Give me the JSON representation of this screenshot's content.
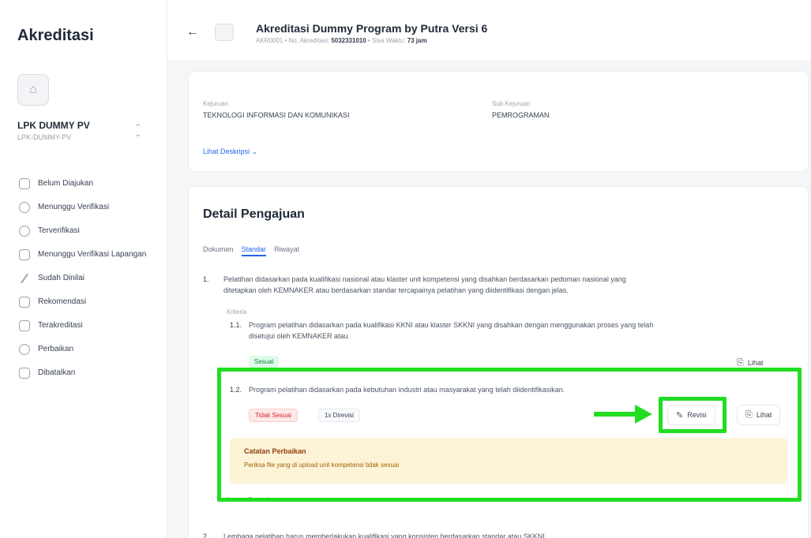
{
  "sidebar": {
    "app_title": "Akreditasi",
    "org_name": "LPK DUMMY PV",
    "org_code": "LPK-DUMMY-PV",
    "items": [
      {
        "label": "Belum Diajukan",
        "icon": "file-icon"
      },
      {
        "label": "Menunggu Verifikasi",
        "icon": "clock-icon"
      },
      {
        "label": "Terverifikasi",
        "icon": "check-circle-icon"
      },
      {
        "label": "Menunggu Verifikasi Lapangan",
        "icon": "map-icon"
      },
      {
        "label": "Sudah Dinilai",
        "icon": "pen-icon"
      },
      {
        "label": "Rekomendasi",
        "icon": "building-icon"
      },
      {
        "label": "Terakreditasi",
        "icon": "badge-icon"
      },
      {
        "label": "Perbaikan",
        "icon": "clock-icon"
      },
      {
        "label": "Dibatalkan",
        "icon": "clipboard-icon"
      }
    ]
  },
  "header": {
    "title": "Akreditasi Dummy Program by Putra Versi 6",
    "meta_prefix": "AKR0001 • No. Akreditasi:",
    "meta_number": "5032331010",
    "meta_mid": " • Sisa Waktu:",
    "meta_time": "73 jam"
  },
  "program": {
    "kejuruan_label": "Kejuruan",
    "kejuruan_value": "TEKNOLOGI INFORMASI DAN KOMUNIKASI",
    "sub_kejuruan_label": "Sub Kejuruan",
    "sub_kejuruan_value": "PEMROGRAMAN",
    "desc_link": "Lihat Deskripsi ⌄"
  },
  "detail": {
    "title": "Detail Pengajuan",
    "tabs": [
      "Dokumen",
      "Standar",
      "Riwayat"
    ],
    "standard_1": {
      "number": "1.",
      "text_line1": "Pelatihan didasarkan pada kualifikasi nasional atau klaster unit kompetensi yang disahkan berdasarkan pedoman nasional yang",
      "text_line2": "ditetapkan oleh KEMNAKER atau berdasarkan standar tercapainya pelatihan yang diidentifikasi dengan jelas.",
      "criteria_label": "Kriteria",
      "crit_1_1": {
        "number": "1.1.",
        "text_line1": "Program pelatihan didasarkan pada kualifikasi KKNI atau klaster SKKNI yang disahkan dengan menggunakan proses yang telah",
        "text_line2": "disetujui oleh KEMNAKER atau.",
        "status": "Sesuai",
        "view_label": "Lihat"
      },
      "crit_1_2": {
        "number": "1.2.",
        "text": "Program pelatihan didasarkan pada kebutuhan industri atau masyarakat yang telah diidentifikasikan.",
        "status": "Tidak Sesuai",
        "revision_count": "1x Direvisi",
        "revise_label": "Revisi",
        "view_label": "Lihat",
        "note_title": "Catatan Perbaikan",
        "note_body": "Periksa file yang di upload unit kompetensi tidak sesuai"
      },
      "next_criteria_label": "Kriteria Tambahan"
    },
    "standard_2": {
      "number": "2.",
      "text": "Lembaga pelatihan harus memberlakukan kualifikasi yang konsisten berdasarkan standar atau SKKNI."
    }
  },
  "annotation": {
    "highlight_color": "#22dd22"
  }
}
